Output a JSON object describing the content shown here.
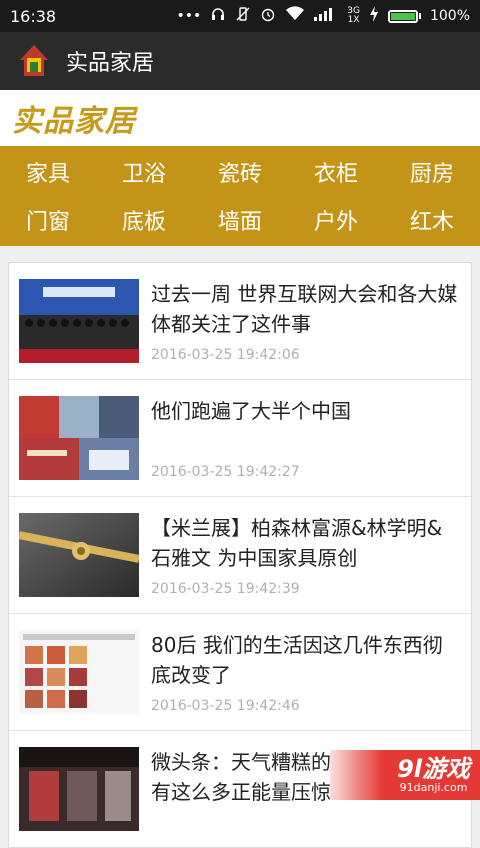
{
  "status": {
    "time": "16:38",
    "network": "3G",
    "sim": "1X",
    "battery": "100%"
  },
  "header": {
    "title": "实品家居"
  },
  "brand": {
    "text": "实品家居"
  },
  "categories": {
    "row1": [
      "家具",
      "卫浴",
      "瓷砖",
      "衣柜",
      "厨房"
    ],
    "row2": [
      "门窗",
      "底板",
      "墙面",
      "户外",
      "红木"
    ]
  },
  "articles": [
    {
      "title": "过去一周 世界互联网大会和各大媒体都关注了这件事",
      "date": "2016-03-25 19:42:06",
      "thumb": "conference-photo"
    },
    {
      "title": "他们跑遍了大半个中国",
      "date": "2016-03-25 19:42:27",
      "thumb": "storefront-collage"
    },
    {
      "title": "【米兰展】柏森林富源&林学明&石雅文 为中国家具原创",
      "date": "2016-03-25 19:42:39",
      "thumb": "gold-furniture-detail"
    },
    {
      "title": "80后 我们的生活因这几件东西彻底改变了",
      "date": "2016-03-25 19:42:46",
      "thumb": "toy-collage"
    },
    {
      "title": "微头条：天气糟糕的",
      "title2": "有这么多正能量压惊",
      "thumb": "shop-interior"
    }
  ],
  "watermark": {
    "text": "9l游戏",
    "sub": "91danji.com"
  }
}
